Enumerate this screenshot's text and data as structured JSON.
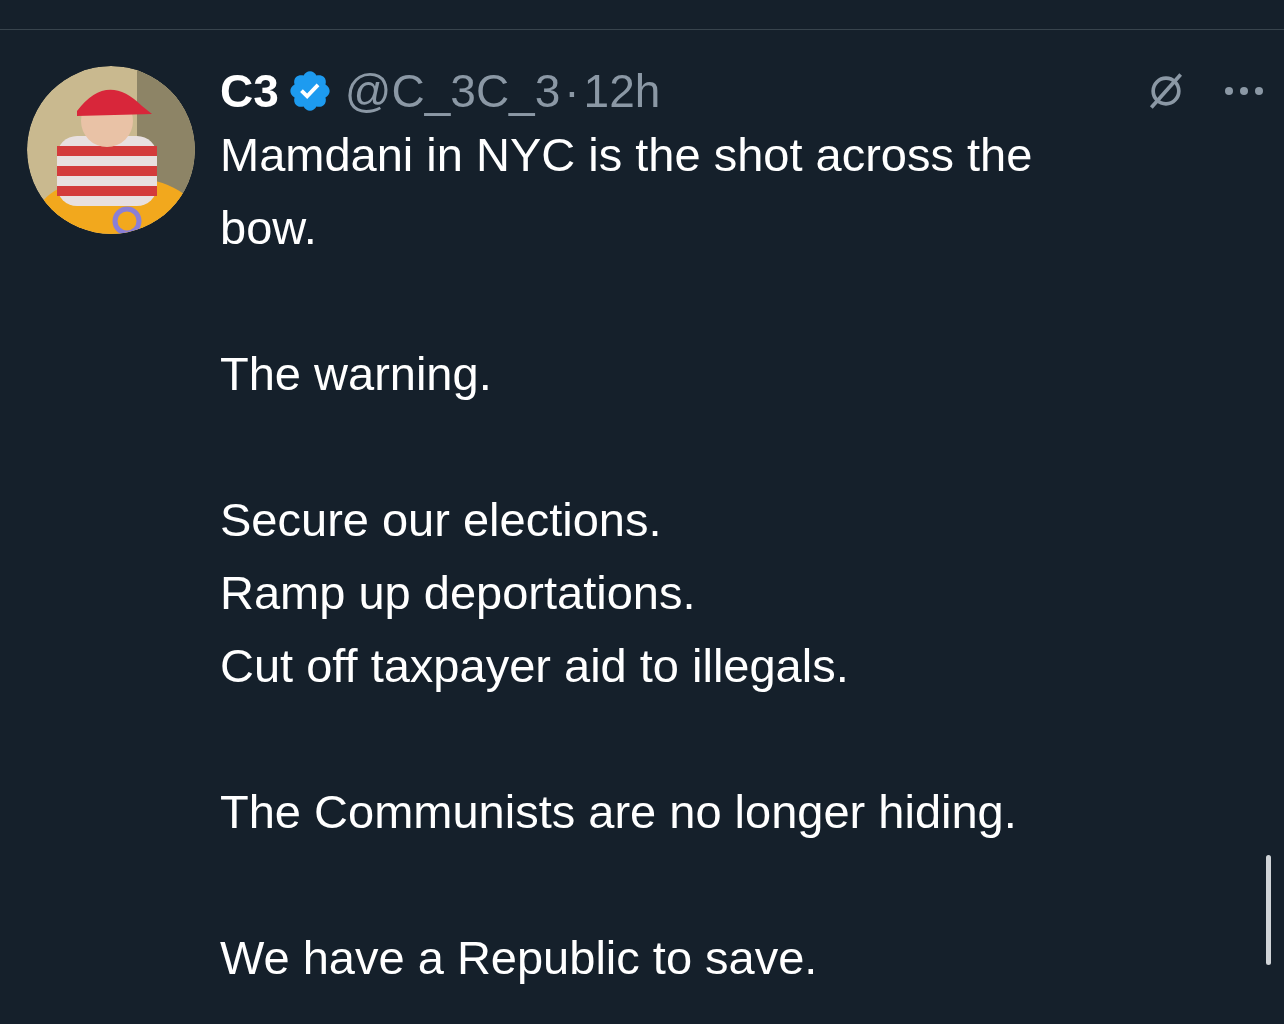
{
  "post": {
    "author_name": "C3",
    "verified": true,
    "handle": "@C_3C_3",
    "separator": "·",
    "time": "12h",
    "paragraphs": [
      [
        "Mamdani in NYC is the shot across the",
        "bow."
      ],
      [
        "The warning."
      ],
      [
        "Secure our elections.",
        "Ramp up deportations.",
        "Cut off taxpayer aid to illegals."
      ],
      [
        "The Communists are no longer hiding."
      ],
      [
        "We have a Republic to save."
      ]
    ]
  }
}
